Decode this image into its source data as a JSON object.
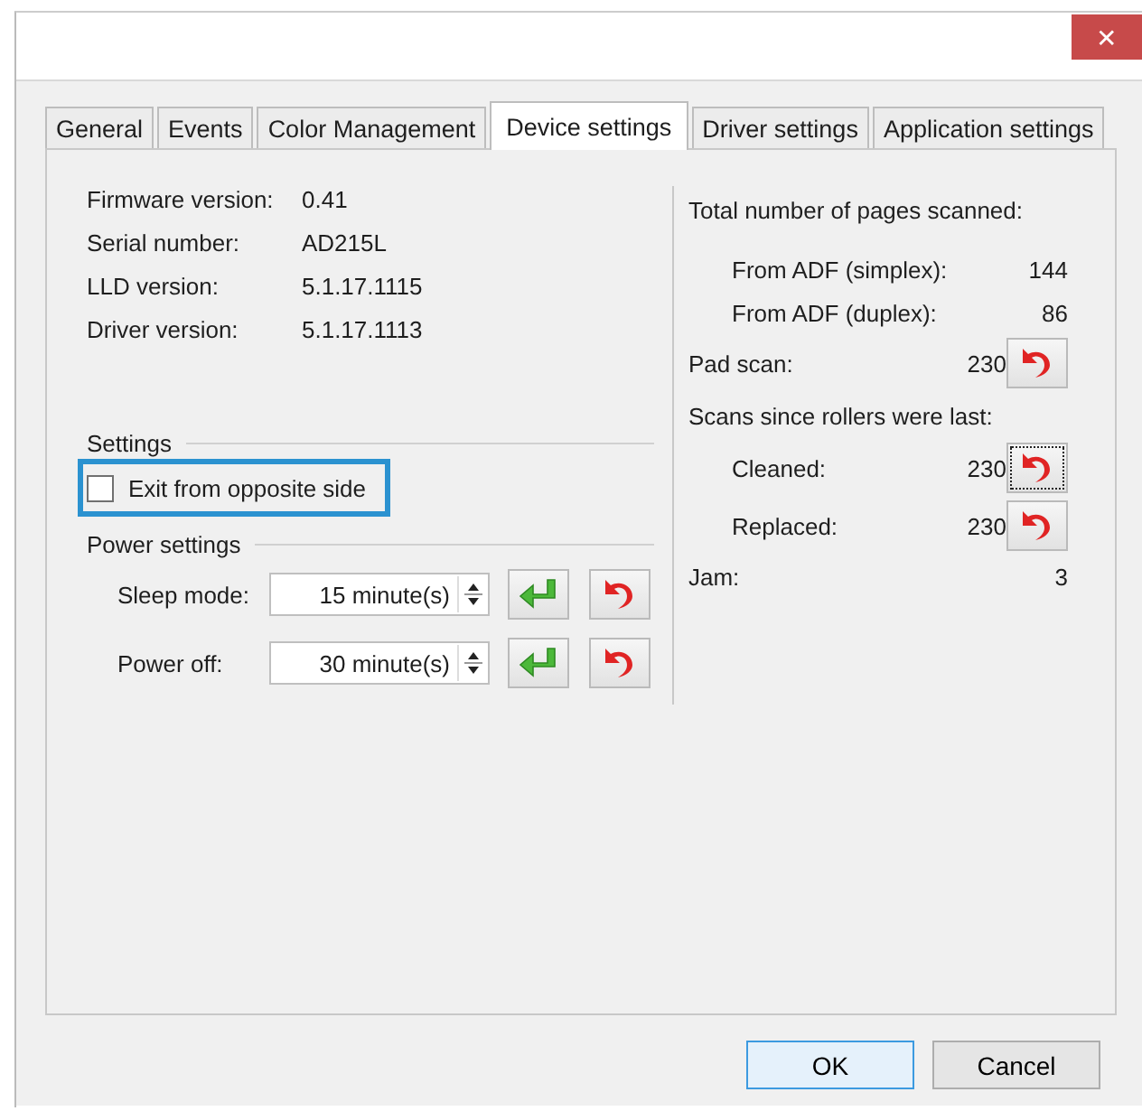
{
  "window": {
    "close": "✕"
  },
  "tabs": [
    {
      "label": "General",
      "selected": false
    },
    {
      "label": "Events",
      "selected": false
    },
    {
      "label": "Color Management",
      "selected": false
    },
    {
      "label": "Device settings",
      "selected": true
    },
    {
      "label": "Driver settings",
      "selected": false
    },
    {
      "label": "Application settings",
      "selected": false
    }
  ],
  "info": [
    {
      "label": "Firmware version:",
      "value": "0.41"
    },
    {
      "label": "Serial number:",
      "value": "AD215L"
    },
    {
      "label": "LLD version:",
      "value": "5.1.17.1115"
    },
    {
      "label": "Driver version:",
      "value": "5.1.17.1113"
    }
  ],
  "settings": {
    "title": "Settings",
    "option": {
      "label": "Exit from opposite side",
      "checked": false,
      "highlighted": true
    }
  },
  "power": {
    "title": "Power settings",
    "rows": [
      {
        "label": "Sleep mode:",
        "value": "15 minute(s)"
      },
      {
        "label": "Power off:",
        "value": "30 minute(s)"
      }
    ]
  },
  "counters": [
    {
      "kind": "heading",
      "label": "Total number of pages scanned:"
    },
    {
      "kind": "count",
      "indent": true,
      "label": "From ADF (simplex):",
      "value": "144"
    },
    {
      "kind": "count",
      "indent": true,
      "label": "From ADF (duplex):",
      "value": "86"
    },
    {
      "kind": "reset",
      "indent": false,
      "label": "Pad scan:",
      "value": "230",
      "focused": false
    },
    {
      "kind": "heading",
      "label": "Scans since rollers were last:"
    },
    {
      "kind": "reset",
      "indent": true,
      "label": "Cleaned:",
      "value": "230",
      "focused": true
    },
    {
      "kind": "reset",
      "indent": true,
      "label": "Replaced:",
      "value": "230",
      "focused": false
    },
    {
      "kind": "count",
      "indent": false,
      "label": "Jam:",
      "value": "3"
    }
  ],
  "buttons": [
    {
      "label": "OK",
      "default": true
    },
    {
      "label": "Cancel",
      "default": false
    }
  ]
}
